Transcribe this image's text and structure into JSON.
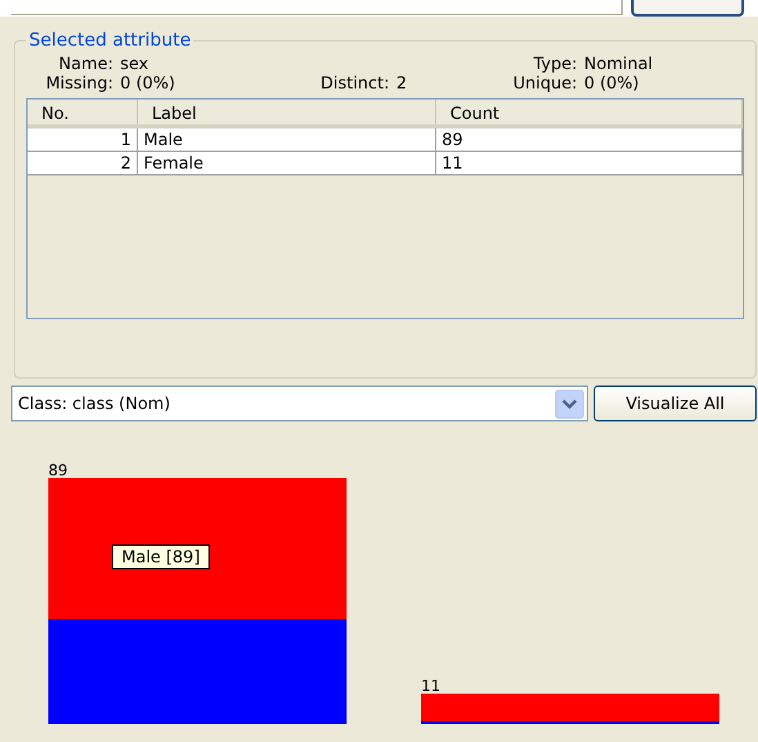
{
  "attribute_panel": {
    "title": "Selected attribute",
    "stats": [
      {
        "label": "Name:",
        "value": "sex"
      },
      {
        "label": "Type:",
        "value": "Nominal"
      },
      {
        "label": "Missing:",
        "value": "0 (0%)"
      },
      {
        "label": "Distinct:",
        "value": "2"
      },
      {
        "label": "Unique:",
        "value": "0 (0%)"
      }
    ],
    "table": {
      "columns": [
        "No.",
        "Label",
        "Count"
      ],
      "rows": [
        [
          "1",
          "Male",
          "89"
        ],
        [
          "2",
          "Female",
          "11"
        ]
      ]
    }
  },
  "class_select": {
    "value": "Class: class (Nom)"
  },
  "visualize_button": "Visualize All",
  "histogram": {
    "tooltip": "Male [89]",
    "bar_labels": [
      "89",
      "11"
    ]
  }
}
